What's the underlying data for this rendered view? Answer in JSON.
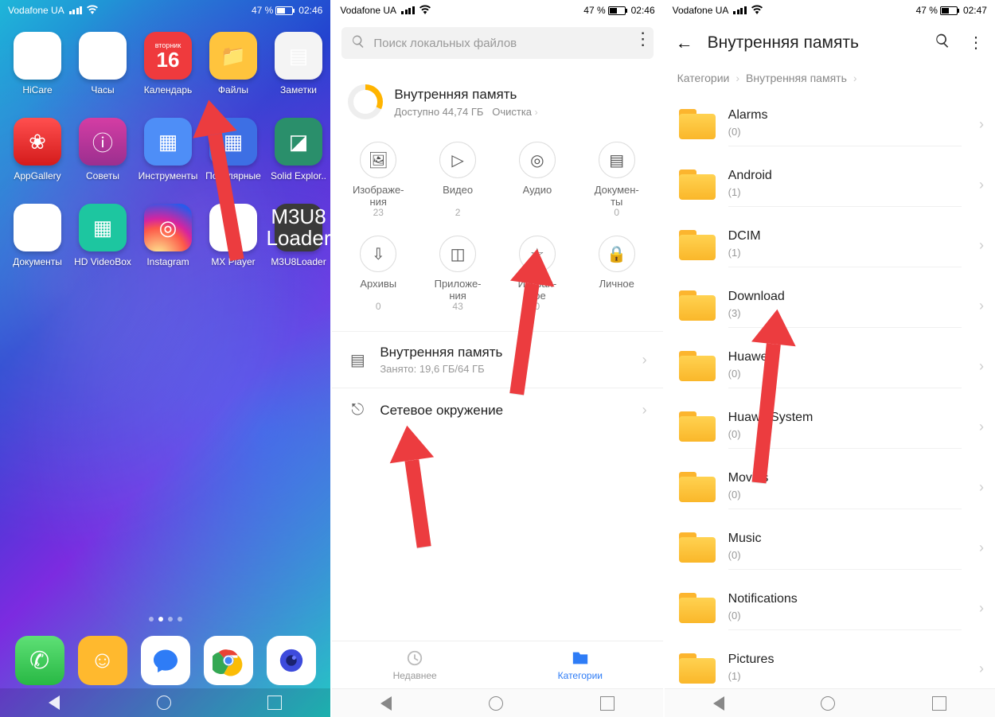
{
  "status": {
    "carrier": "Vodafone UA",
    "battery": "47 %",
    "time1": "02:46",
    "time3": "02:47"
  },
  "home": {
    "apps": [
      {
        "label": "HiCare",
        "cls": "bg-white",
        "g": "♡"
      },
      {
        "label": "Часы",
        "cls": "bg-white",
        "g": "◷"
      },
      {
        "label": "Календарь",
        "cls": "bg-cal",
        "g": "16",
        "sub": "вторник"
      },
      {
        "label": "Файлы",
        "cls": "bg-files",
        "g": "📁"
      },
      {
        "label": "Заметки",
        "cls": "bg-notes",
        "g": "▤"
      },
      {
        "label": "AppGallery",
        "cls": "bg-gallery",
        "g": "❀"
      },
      {
        "label": "Советы",
        "cls": "bg-tips",
        "g": "ⓘ"
      },
      {
        "label": "Инструменты",
        "cls": "bg-tools",
        "g": "▦"
      },
      {
        "label": "Популярные",
        "cls": "bg-pop",
        "g": "▦"
      },
      {
        "label": "Solid Explor..",
        "cls": "bg-solid",
        "g": "◪"
      },
      {
        "label": "Документы",
        "cls": "bg-docs",
        "g": "▤"
      },
      {
        "label": "HD VideoBox",
        "cls": "bg-hd",
        "g": "▦"
      },
      {
        "label": "Instagram",
        "cls": "bg-ig",
        "g": "◎"
      },
      {
        "label": "MX Player",
        "cls": "bg-mx",
        "g": "▶"
      },
      {
        "label": "M3U8Loader",
        "cls": "bg-m3u8",
        "g": "M3U8 Loader"
      }
    ],
    "dock": [
      {
        "cls": "bg-phone",
        "name": "phone-app",
        "g": "✆"
      },
      {
        "cls": "bg-sms",
        "name": "contacts-app",
        "g": "☺"
      },
      {
        "cls": "bg-msgr",
        "name": "messages-app",
        "svg": "msgr"
      },
      {
        "cls": "bg-chrome",
        "name": "chrome-app",
        "svg": "chrome"
      },
      {
        "cls": "bg-cam",
        "name": "camera-app",
        "svg": "cam"
      }
    ]
  },
  "files": {
    "search_placeholder": "Поиск локальных файлов",
    "storage_title": "Внутренняя память",
    "storage_sub": "Доступно 44,74 ГБ",
    "cleanup": "Очистка",
    "cats": [
      {
        "label": "Изображе-\nния",
        "count": "23",
        "g": "🖼"
      },
      {
        "label": "Видео",
        "count": "2",
        "g": "▷"
      },
      {
        "label": "Аудио",
        "count": "",
        "g": "◎"
      },
      {
        "label": "Докумен-\nты",
        "count": "0",
        "g": "▤"
      },
      {
        "label": "Архивы",
        "count": "0",
        "g": "⇩"
      },
      {
        "label": "Приложе-\nния",
        "count": "43",
        "g": "◫"
      },
      {
        "label": "Избран-\nное",
        "count": "0",
        "g": "☆"
      },
      {
        "label": "Личное",
        "count": "",
        "g": "🔒"
      }
    ],
    "internal_title": "Внутренняя память",
    "internal_sub": "Занято: 19,6 ГБ/64 ГБ",
    "network": "Сетевое окружение",
    "tab_recent": "Недавнее",
    "tab_categories": "Категории"
  },
  "browser": {
    "title": "Внутренняя память",
    "crumb1": "Категории",
    "crumb2": "Внутренняя память",
    "dirs": [
      {
        "name": "Alarms",
        "count": "(0)"
      },
      {
        "name": "Android",
        "count": "(1)"
      },
      {
        "name": "DCIM",
        "count": "(1)"
      },
      {
        "name": "Download",
        "count": "(3)"
      },
      {
        "name": "Huawei",
        "count": "(0)"
      },
      {
        "name": "HuaweiSystem",
        "count": "(0)"
      },
      {
        "name": "Movies",
        "count": "(0)"
      },
      {
        "name": "Music",
        "count": "(0)"
      },
      {
        "name": "Notifications",
        "count": "(0)"
      },
      {
        "name": "Pictures",
        "count": "(1)"
      }
    ]
  }
}
